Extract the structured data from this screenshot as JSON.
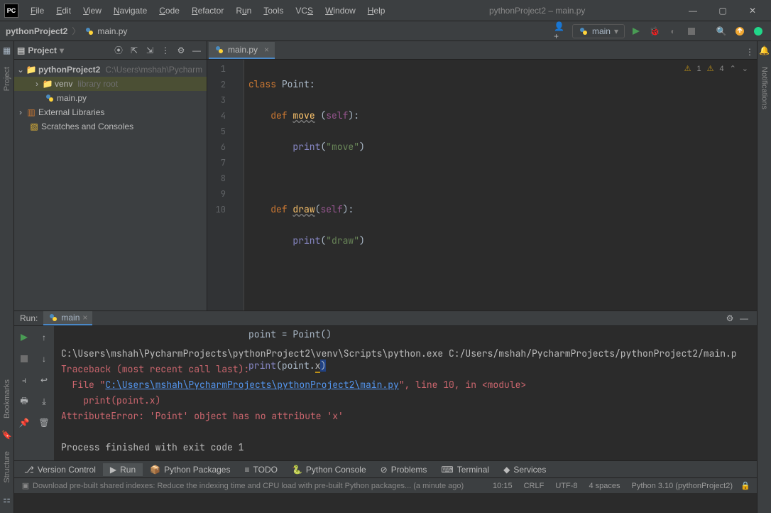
{
  "window": {
    "title": "pythonProject2 – main.py",
    "menu": [
      "File",
      "Edit",
      "View",
      "Navigate",
      "Code",
      "Refactor",
      "Run",
      "Tools",
      "VCS",
      "Window",
      "Help"
    ]
  },
  "breadcrumb": {
    "project": "pythonProject2",
    "file": "main.py"
  },
  "run_config": {
    "name": "main"
  },
  "project_tool": {
    "title": "Project",
    "root": {
      "name": "pythonProject2",
      "hint": "C:\\Users\\mshah\\Pycharm"
    },
    "venv": {
      "name": "venv",
      "hint": "library root"
    },
    "file": {
      "name": "main.py"
    },
    "ext": {
      "name": "External Libraries"
    },
    "scratch": {
      "name": "Scratches and Consoles"
    }
  },
  "editor": {
    "tab_name": "main.py",
    "inspections": {
      "error_count": "1",
      "warn_count": "4"
    },
    "lines": [
      "1",
      "2",
      "3",
      "4",
      "5",
      "6",
      "7",
      "8",
      "9",
      "10"
    ],
    "code": {
      "l1": {
        "kw": "class",
        "name": "Point",
        "colon": ":"
      },
      "l2": {
        "kw": "def",
        "fn": "move",
        "open": " (",
        "self": "self",
        "close": "):"
      },
      "l3": {
        "fn": "print",
        "open": "(",
        "str": "\"move\"",
        "close": ")"
      },
      "l5": {
        "kw": "def",
        "fn": "draw",
        "open": "(",
        "self": "self",
        "close": "):"
      },
      "l6": {
        "fn": "print",
        "open": "(",
        "str": "\"draw\"",
        "close": ")"
      },
      "l9": {
        "lhs": "point = Point()"
      },
      "l10": {
        "fn": "print",
        "open": "(",
        "obj": "point.",
        "attr": "x",
        "close": ")"
      }
    }
  },
  "run": {
    "label": "Run:",
    "tab": "main",
    "console": {
      "cmd": "C:\\Users\\mshah\\PycharmProjects\\pythonProject2\\venv\\Scripts\\python.exe C:/Users/mshah/PycharmProjects/pythonProject2/main.p",
      "tb": "Traceback (most recent call last):",
      "file_pre": "  File \"",
      "file_link": "C:\\Users\\mshah\\PycharmProjects\\pythonProject2\\main.py",
      "file_post": "\", line 10, in <module>",
      "stmt": "    print(point.x)",
      "err": "AttributeError: 'Point' object has no attribute 'x'",
      "exit": "Process finished with exit code 1"
    }
  },
  "toolwindows": {
    "version_control": "Version Control",
    "run": "Run",
    "packages": "Python Packages",
    "todo": "TODO",
    "console": "Python Console",
    "problems": "Problems",
    "terminal": "Terminal",
    "services": "Services"
  },
  "left_gutter": {
    "project": "Project",
    "bookmarks": "Bookmarks",
    "structure": "Structure"
  },
  "right_gutter": {
    "notifications": "Notifications"
  },
  "status": {
    "msg": "Download pre-built shared indexes: Reduce the indexing time and CPU load with pre-built Python packages... (a minute ago)",
    "pos": "10:15",
    "sep": "CRLF",
    "enc": "UTF-8",
    "indent": "4 spaces",
    "interp": "Python 3.10 (pythonProject2)"
  }
}
